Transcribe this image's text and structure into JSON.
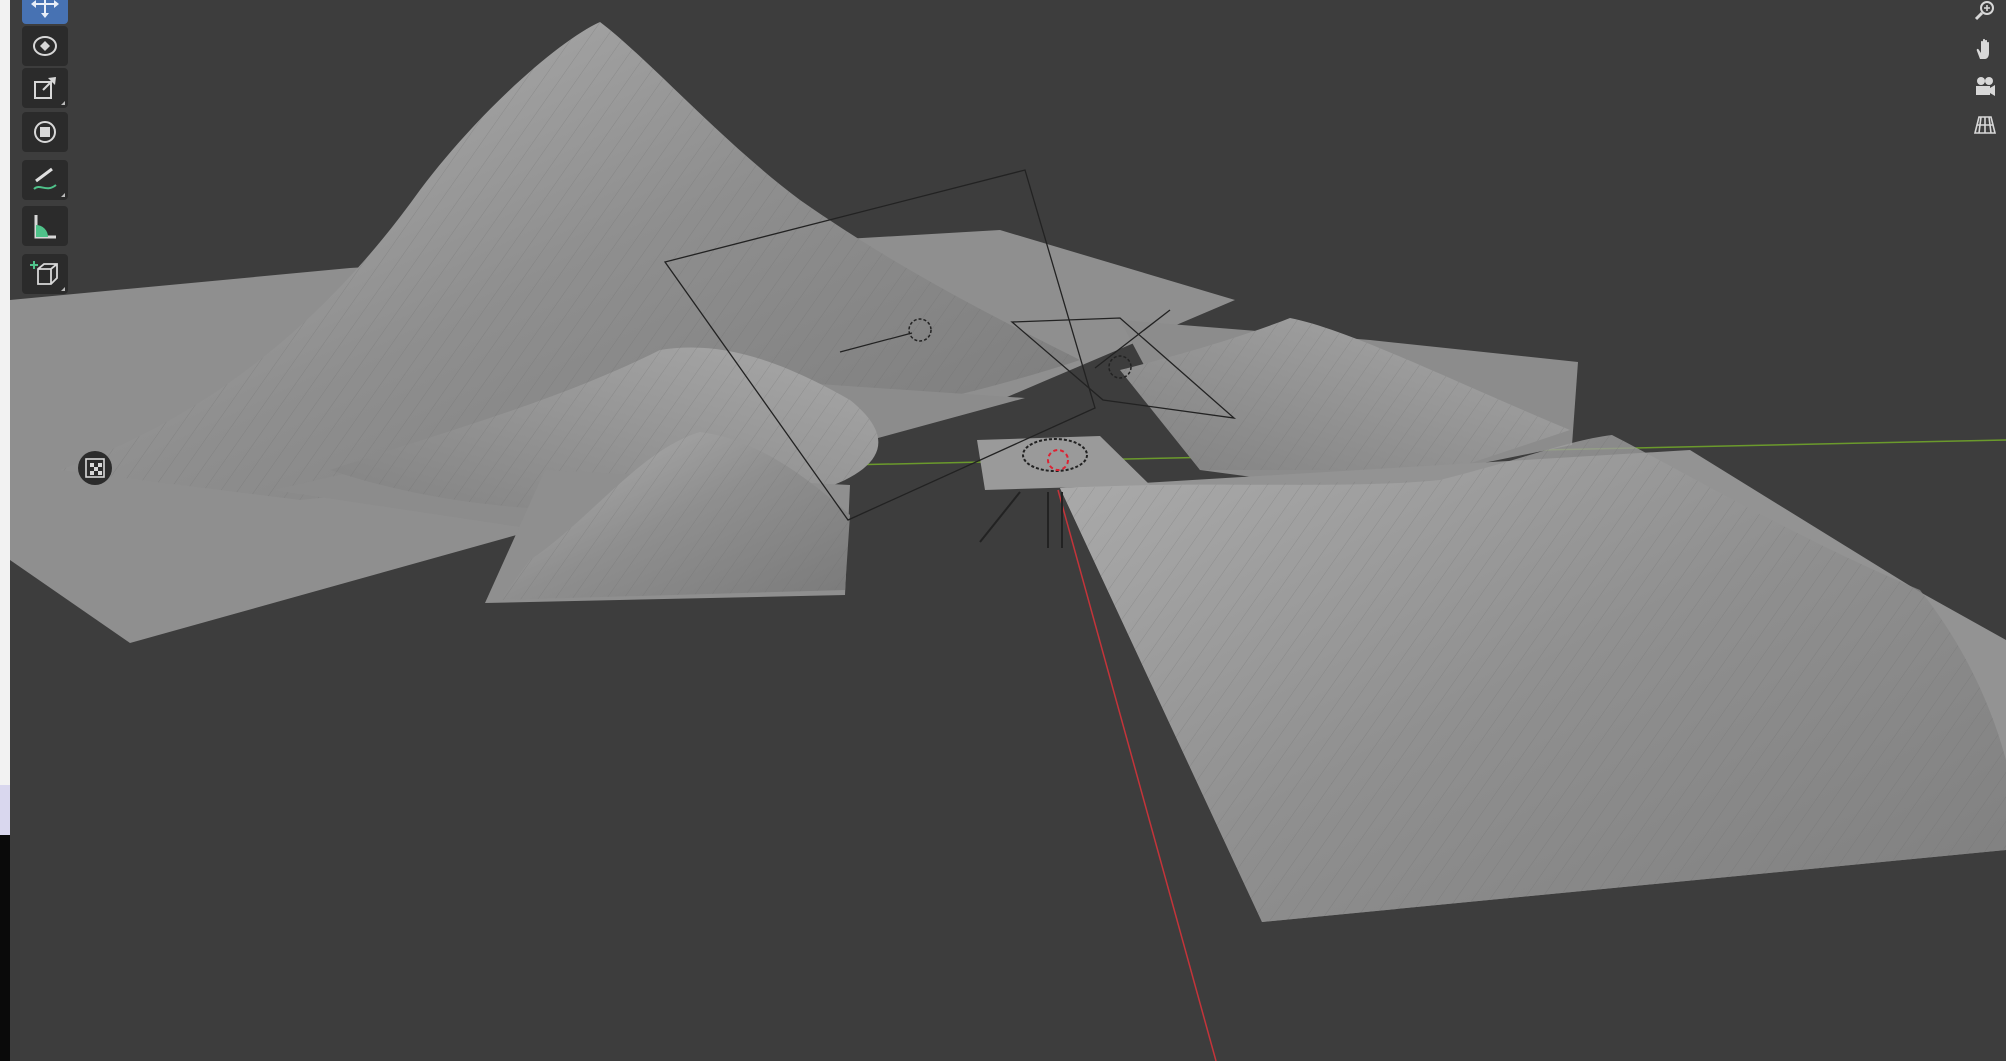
{
  "app": {
    "name": "3D Viewport"
  },
  "colors": {
    "viewport_bg": "#3d3d3d",
    "toolbar_bg": "#2b2b2b",
    "active_tool": "#4772b3",
    "x_axis": "#c4343a",
    "y_axis": "#6b9a2c",
    "terrain": "#8e8e8e",
    "icon": "#d8d8d8"
  },
  "toolbar": {
    "tools": [
      {
        "name": "move-tool",
        "icon": "move-icon",
        "active": true
      },
      {
        "name": "rotate-tool",
        "icon": "rotate-icon",
        "active": false
      },
      {
        "name": "scale-tool",
        "icon": "scale-icon",
        "active": false
      },
      {
        "name": "transform-tool",
        "icon": "transform-icon",
        "active": false
      },
      {
        "name": "annotate-tool",
        "icon": "annotate-icon",
        "active": false
      },
      {
        "name": "measure-tool",
        "icon": "measure-icon",
        "active": false
      },
      {
        "name": "add-cube-tool",
        "icon": "add-cube-icon",
        "active": false
      }
    ]
  },
  "navigation": [
    {
      "name": "zoom",
      "icon": "zoom-in-icon"
    },
    {
      "name": "pan",
      "icon": "hand-icon"
    },
    {
      "name": "camera-view",
      "icon": "camera-icon"
    },
    {
      "name": "perspective-toggle",
      "icon": "grid-icon"
    }
  ],
  "scene": {
    "objects": [
      "large-mountain",
      "small-mountain-left",
      "small-mountain-center",
      "mountain-right-back",
      "mountain-right-front",
      "center-plane",
      "camera-frame",
      "light-left",
      "light-right"
    ]
  }
}
